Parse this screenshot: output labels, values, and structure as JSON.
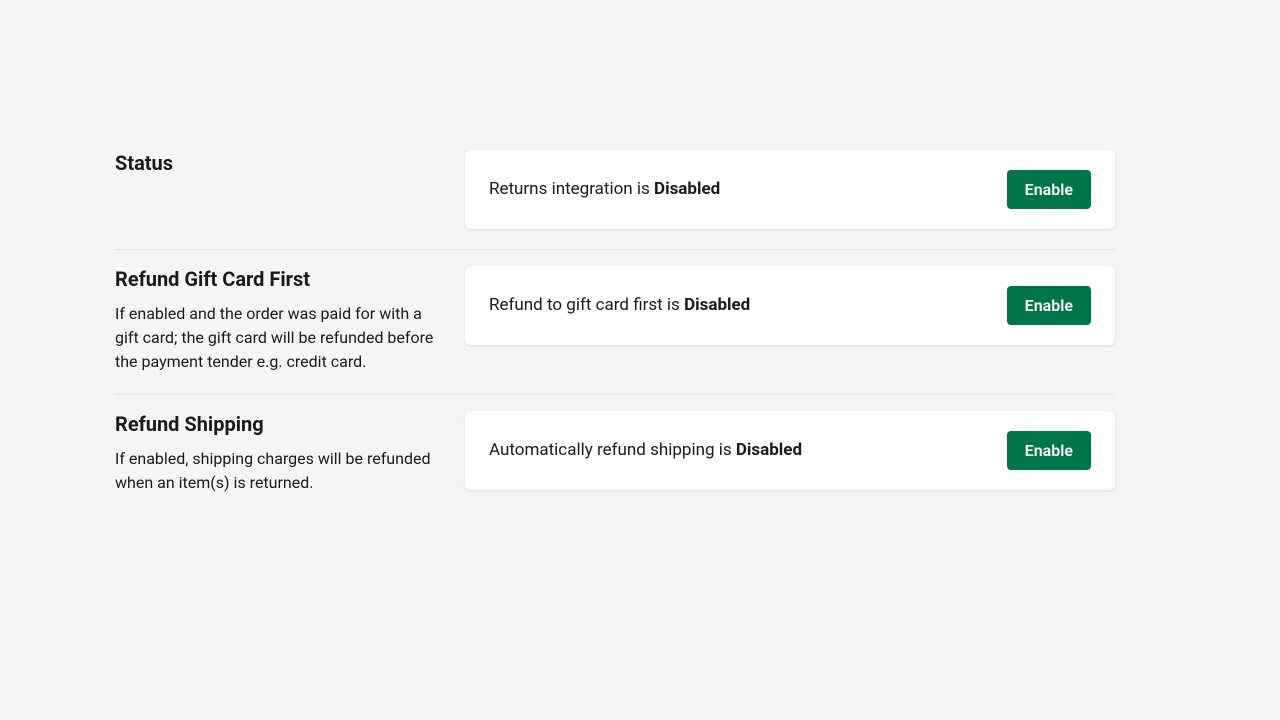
{
  "sections": {
    "status": {
      "title": "Status",
      "card_prefix": "Returns integration is ",
      "card_status": "Disabled",
      "button_label": "Enable"
    },
    "gift_card": {
      "title": "Refund Gift Card First",
      "description": "If enabled and the order was paid for with a gift card; the gift card will be refunded before the payment tender e.g. credit card.",
      "card_prefix": "Refund to gift card first is ",
      "card_status": "Disabled",
      "button_label": "Enable"
    },
    "shipping": {
      "title": "Refund Shipping",
      "description": "If enabled, shipping charges will be refunded when an item(s) is returned.",
      "card_prefix": "Automatically refund shipping is ",
      "card_status": "Disabled",
      "button_label": "Enable"
    }
  }
}
